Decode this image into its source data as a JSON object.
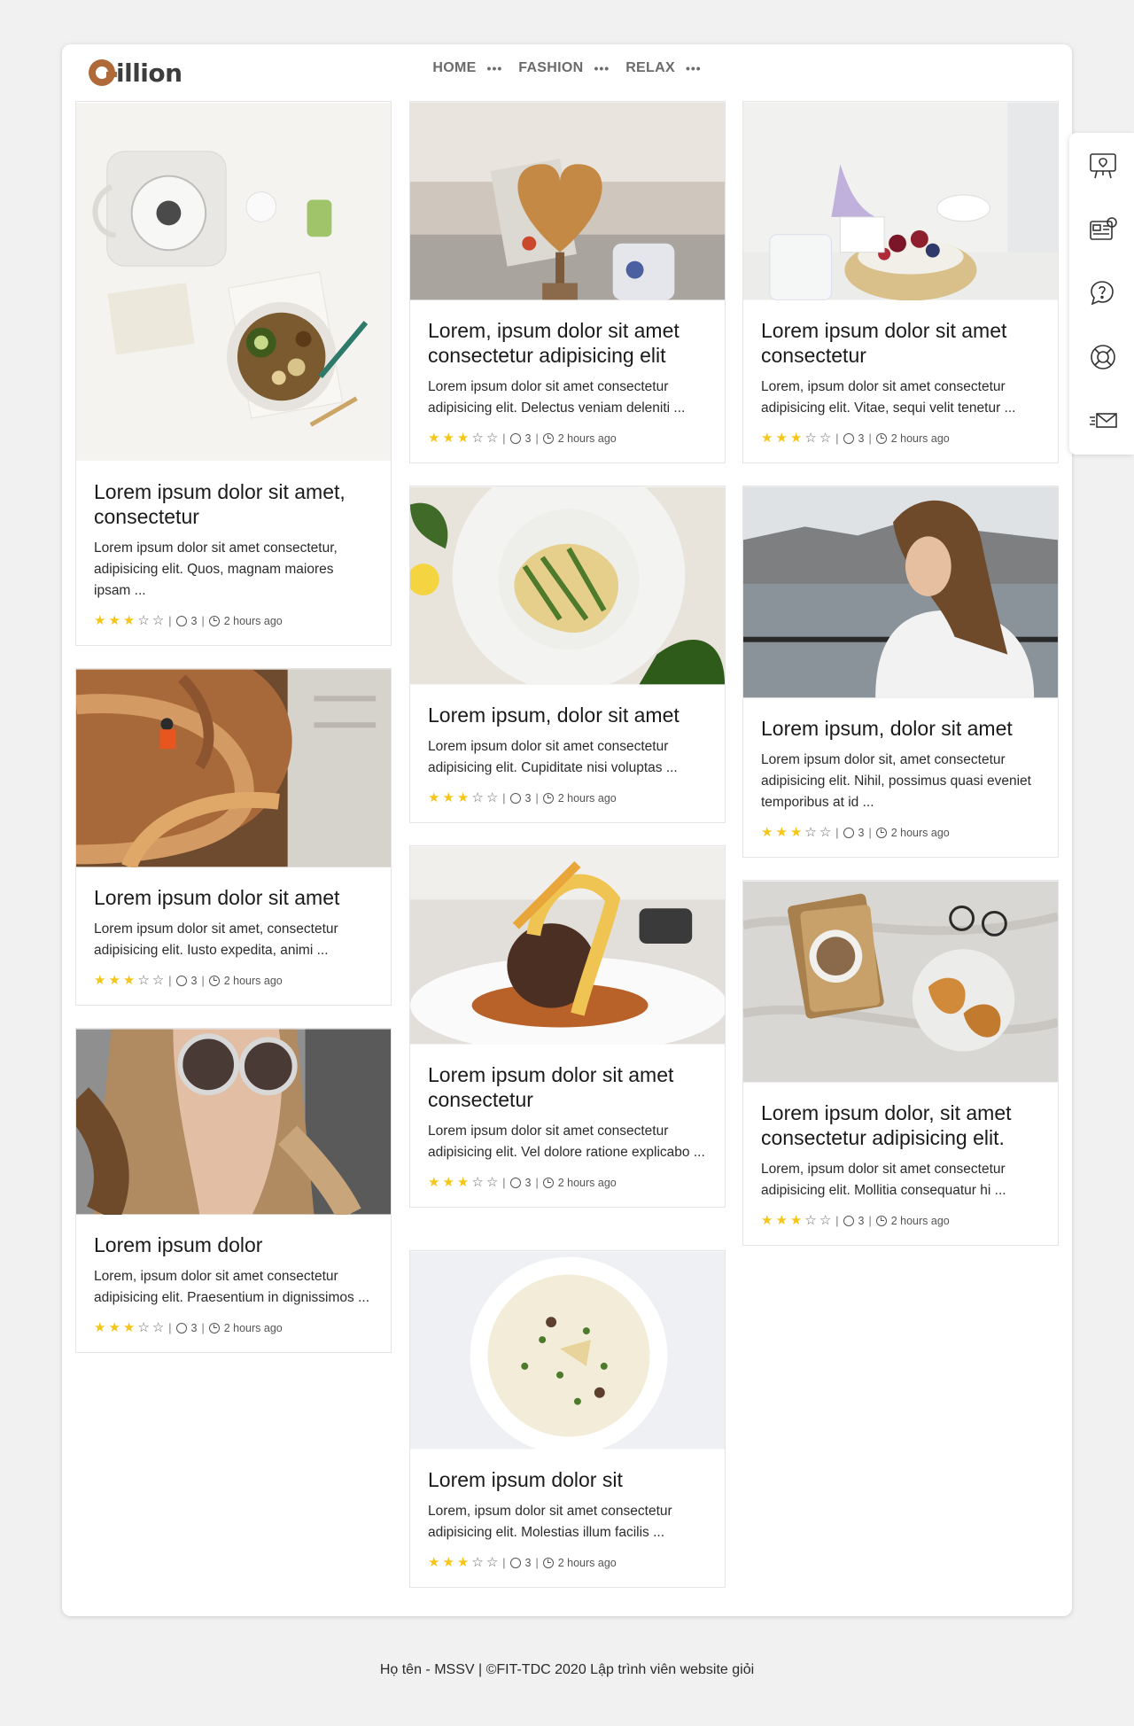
{
  "brand": {
    "logo_text": "illion"
  },
  "nav": [
    {
      "label": "HOME",
      "dots": "•••"
    },
    {
      "label": "FASHION",
      "dots": "•••"
    },
    {
      "label": "RELAX",
      "dots": "•••"
    }
  ],
  "side_toolbar": [
    "presentation-icon",
    "news-icon",
    "help-chat-icon",
    "lifebuoy-icon",
    "fast-mail-icon"
  ],
  "cards": [
    {
      "title": "Lorem ipsum dolor sit amet, consectetur",
      "text": "Lorem ipsum dolor sit amet consectetur, adipisicing elit. Quos, magnam maiores ipsam ...",
      "rating": 3,
      "comments": "3",
      "time": "2 hours ago",
      "image": "food-flatlay-telephone"
    },
    {
      "title": "Lorem ipsum dolor sit amet",
      "text": "Lorem ipsum dolor sit amet, consectetur adipisicing elit. Iusto expedita, animi ...",
      "rating": 3,
      "comments": "3",
      "time": "2 hours ago",
      "image": "spiral-staircase"
    },
    {
      "title": "Lorem ipsum dolor",
      "text": "Lorem, ipsum dolor sit amet consectetur adipisicing elit. Praesentium in dignissimos ...",
      "rating": 3,
      "comments": "3",
      "time": "2 hours ago",
      "image": "woman-sunglasses"
    },
    {
      "title": "Lorem, ipsum dolor sit amet consectetur adipisicing elit",
      "text": "Lorem ipsum dolor sit amet consectetur adipisicing elit. Delectus veniam deleniti ...",
      "rating": 3,
      "comments": "3",
      "time": "2 hours ago",
      "image": "heart-waffle"
    },
    {
      "title": "Lorem ipsum, dolor sit amet",
      "text": "Lorem ipsum dolor sit amet consectetur adipisicing elit. Cupiditate nisi voluptas ...",
      "rating": 3,
      "comments": "3",
      "time": "2 hours ago",
      "image": "pasta-plate"
    },
    {
      "title": "Lorem ipsum dolor sit amet consectetur",
      "text": "Lorem ipsum dolor sit amet consectetur adipisicing elit. Vel dolore ratione explicabo ...",
      "rating": 3,
      "comments": "3",
      "time": "2 hours ago",
      "image": "gourmet-dish"
    },
    {
      "title": "Lorem ipsum dolor sit",
      "text": "Lorem, ipsum dolor sit amet consectetur adipisicing elit. Molestias illum facilis ...",
      "rating": 3,
      "comments": "3",
      "time": "2 hours ago",
      "image": "risotto-bowl"
    },
    {
      "title": "Lorem ipsum dolor sit amet consectetur",
      "text": "Lorem, ipsum dolor sit amet consectetur adipisicing elit. Vitae, sequi velit tenetur ...",
      "rating": 3,
      "comments": "3",
      "time": "2 hours ago",
      "image": "fruit-bowl"
    },
    {
      "title": "Lorem ipsum, dolor sit amet",
      "text": "Lorem ipsum dolor sit, amet consectetur adipisicing elit. Nihil, possimus quasi eveniet temporibus at id ...",
      "rating": 3,
      "comments": "3",
      "time": "2 hours ago",
      "image": "woman-waterfront"
    },
    {
      "title": "Lorem ipsum dolor, sit amet consectetur adipisicing elit.",
      "text": "Lorem, ipsum dolor sit amet consectetur adipisicing elit. Mollitia consequatur hi ...",
      "rating": 3,
      "comments": "3",
      "time": "2 hours ago",
      "image": "coffee-croissant-bed"
    }
  ],
  "footer": {
    "text": "Họ tên - MSSV | ©FIT-TDC 2020 Lập trình viên website giỏi"
  }
}
